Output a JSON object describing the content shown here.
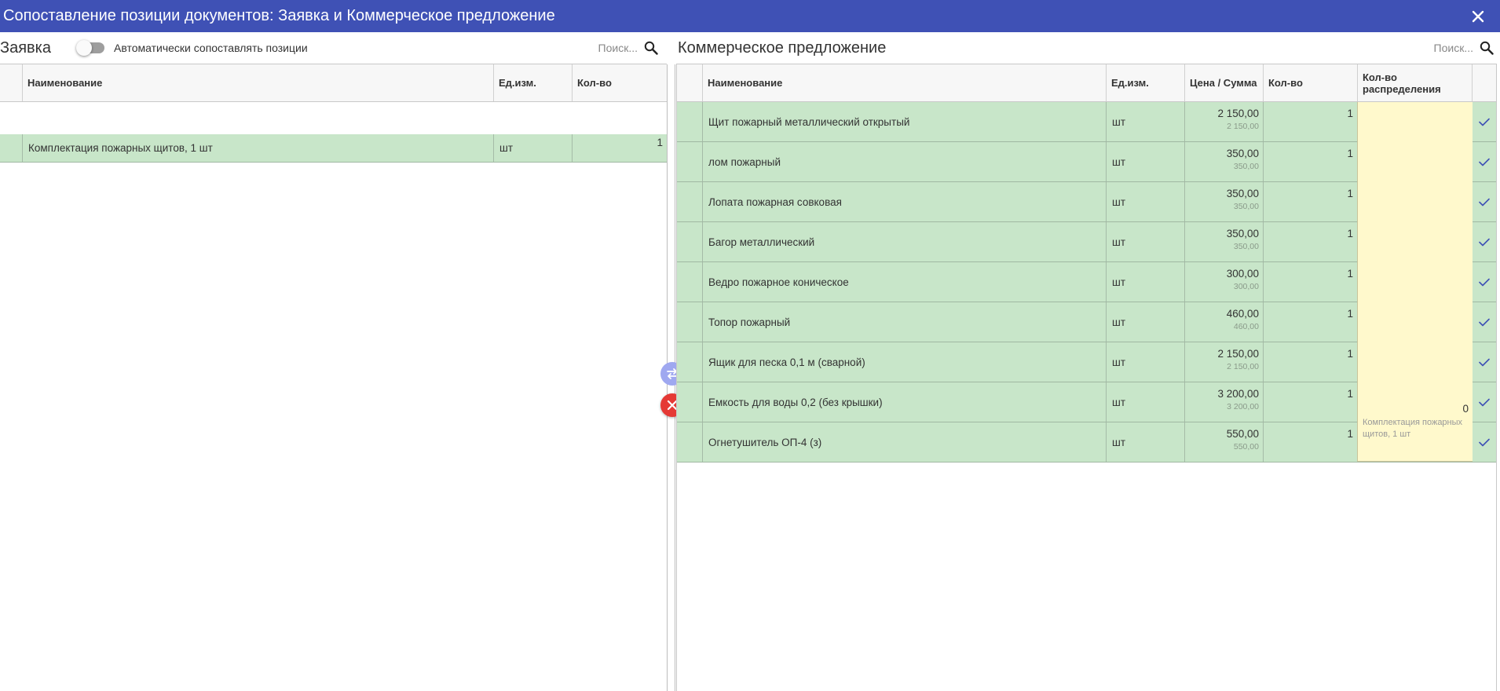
{
  "window": {
    "title": "Сопоставление позиции документов: Заявка и Коммерческое предложение",
    "close_icon": "close-icon"
  },
  "left_panel": {
    "title": "Заявка",
    "auto_match": {
      "label": "Автоматически сопоставлять позиции",
      "enabled": false
    },
    "search": {
      "placeholder": "Поиск..."
    },
    "columns": [
      "Наименование",
      "Ед.изм.",
      "Кол-во"
    ],
    "rows": [
      {
        "name": "Комплектация пожарных щитов, 1 шт",
        "unit": "шт",
        "qty": "1"
      }
    ]
  },
  "right_panel": {
    "title": "Коммерческое предложение",
    "search": {
      "placeholder": "Поиск..."
    },
    "columns": [
      "Наименование",
      "Ед.изм.",
      "Цена / Сумма",
      "Кол-во",
      "Кол-во распределения"
    ],
    "rows": [
      {
        "name": "Щит пожарный металлический открытый",
        "unit": "шт",
        "price": "2 150,00",
        "sum": "2 150,00",
        "qty": "1"
      },
      {
        "name": "лом пожарный",
        "unit": "шт",
        "price": "350,00",
        "sum": "350,00",
        "qty": "1"
      },
      {
        "name": "Лопата пожарная совковая",
        "unit": "шт",
        "price": "350,00",
        "sum": "350,00",
        "qty": "1"
      },
      {
        "name": "Багор металлический",
        "unit": "шт",
        "price": "350,00",
        "sum": "350,00",
        "qty": "1"
      },
      {
        "name": "Ведро пожарное коническое",
        "unit": "шт",
        "price": "300,00",
        "sum": "300,00",
        "qty": "1"
      },
      {
        "name": "Топор пожарный",
        "unit": "шт",
        "price": "460,00",
        "sum": "460,00",
        "qty": "1"
      },
      {
        "name": "Ящик для песка 0,1 м (сварной)",
        "unit": "шт",
        "price": "2 150,00",
        "sum": "2 150,00",
        "qty": "1"
      },
      {
        "name": "Емкость для воды 0,2 (без крышки)",
        "unit": "шт",
        "price": "3 200,00",
        "sum": "3 200,00",
        "qty": "1"
      },
      {
        "name": "Огнетушитель ОП-4 (з)",
        "unit": "шт",
        "price": "550,00",
        "sum": "550,00",
        "qty": "1"
      }
    ],
    "allocation": {
      "qty": "0",
      "item": "Комплектация пожарных щитов, 1 шт"
    }
  },
  "actions": {
    "swap_icon": "swap-icon",
    "remove_icon": "close-icon"
  },
  "colors": {
    "header": "#3f51b5",
    "matched_row": "#c8e6c9",
    "allocation": "#fff9cc",
    "remove": "#e53935",
    "swap": "#9fa8f0",
    "check": "#3f51b5"
  }
}
